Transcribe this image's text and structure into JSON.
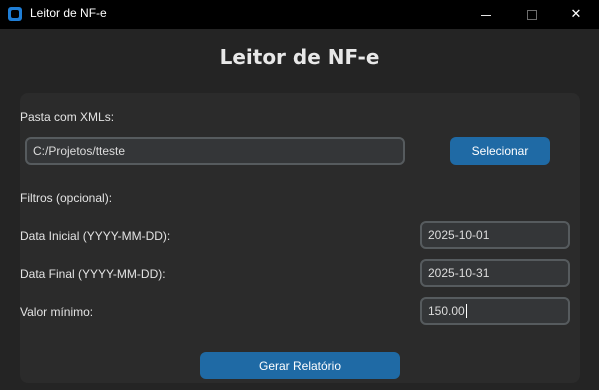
{
  "window": {
    "title": "Leitor de NF-e",
    "controls": {
      "minimize": "",
      "maximize": "",
      "close": "✕"
    }
  },
  "header": {
    "title": "Leitor de NF-e"
  },
  "folder": {
    "label": "Pasta com XMLs:",
    "value": "C:/Projetos/tteste",
    "select_label": "Selecionar"
  },
  "filters": {
    "label": "Filtros (opcional):",
    "start_date": {
      "label": "Data Inicial (YYYY-MM-DD):",
      "value": "2025-10-01"
    },
    "end_date": {
      "label": "Data Final (YYYY-MM-DD):",
      "value": "2025-10-31"
    },
    "min_value": {
      "label": "Valor mínimo:",
      "value": "150.00"
    }
  },
  "actions": {
    "generate_label": "Gerar Relatório"
  },
  "colors": {
    "accent": "#1f6aa5",
    "background": "#242424",
    "frame": "#2b2b2b"
  }
}
